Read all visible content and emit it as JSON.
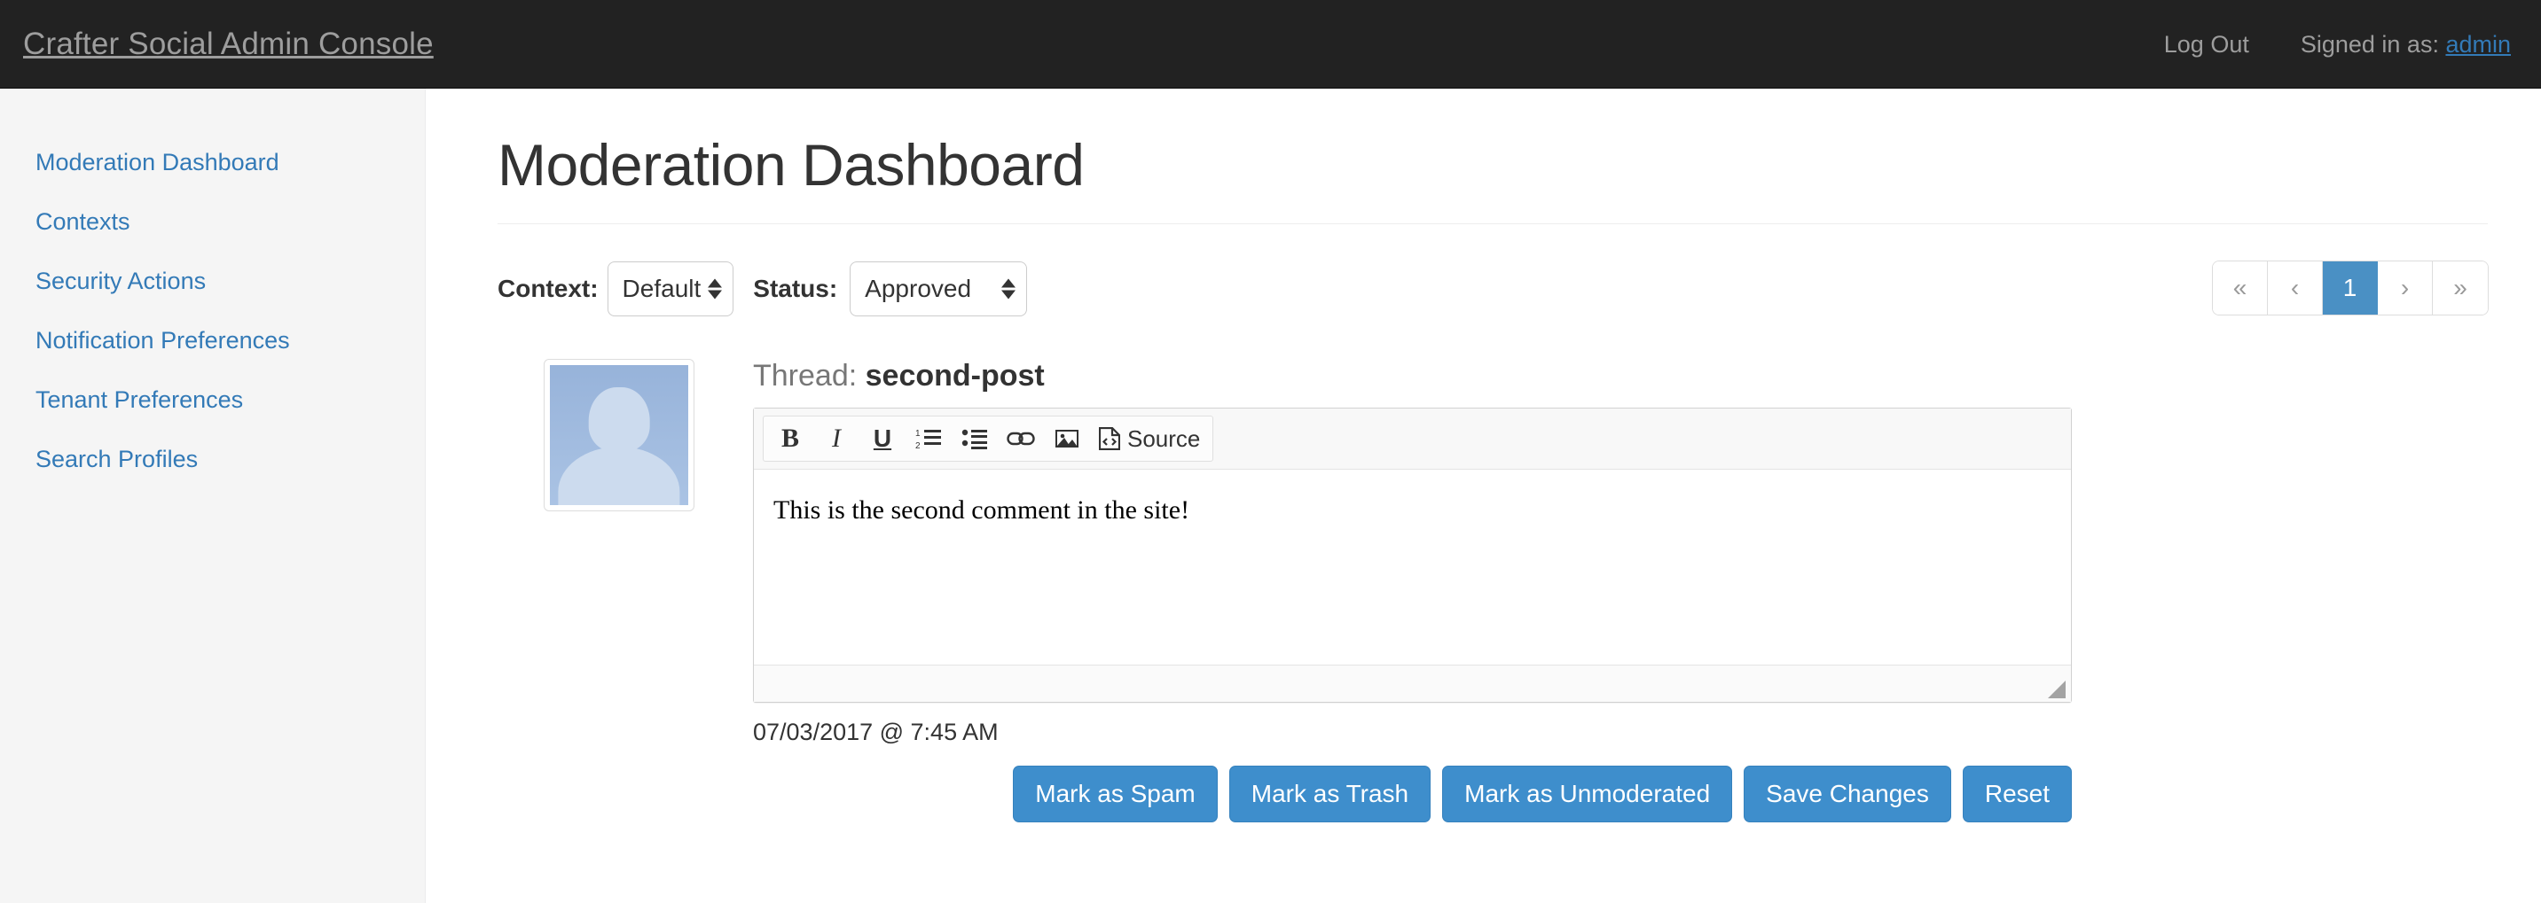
{
  "navbar": {
    "brand": "Crafter Social Admin Console",
    "logout_label": "Log Out",
    "signed_in_prefix": "Signed in as: ",
    "username": "admin"
  },
  "sidebar": {
    "items": [
      {
        "label": "Moderation Dashboard"
      },
      {
        "label": "Contexts"
      },
      {
        "label": "Security Actions"
      },
      {
        "label": "Notification Preferences"
      },
      {
        "label": "Tenant Preferences"
      },
      {
        "label": "Search Profiles"
      }
    ]
  },
  "main": {
    "page_title": "Moderation Dashboard",
    "filters": {
      "context_label": "Context:",
      "context_value": "Default",
      "status_label": "Status:",
      "status_value": "Approved"
    },
    "pagination": {
      "first": "«",
      "prev": "‹",
      "current": "1",
      "next": "›",
      "last": "»"
    },
    "post": {
      "thread_prefix": "Thread: ",
      "thread_name": "second-post",
      "editor": {
        "toolbar": {
          "bold": "B",
          "italic": "I",
          "underline": "U",
          "numbered_list": "numbered-list-icon",
          "bullet_list": "bullet-list-icon",
          "link": "link-icon",
          "image": "image-icon",
          "source": "Source"
        },
        "content": "This is the second comment in the site!"
      },
      "timestamp": "07/03/2017 @ 7:45 AM",
      "buttons": [
        {
          "label": "Mark as Spam"
        },
        {
          "label": "Mark as Trash"
        },
        {
          "label": "Mark as Unmoderated"
        },
        {
          "label": "Save Changes"
        },
        {
          "label": "Reset"
        }
      ]
    }
  },
  "colors": {
    "navbar_bg": "#222222",
    "link_blue": "#337ab7",
    "button_blue": "#3e8ecc",
    "pagination_active": "#4a90c4",
    "sidebar_bg": "#f5f5f5"
  }
}
